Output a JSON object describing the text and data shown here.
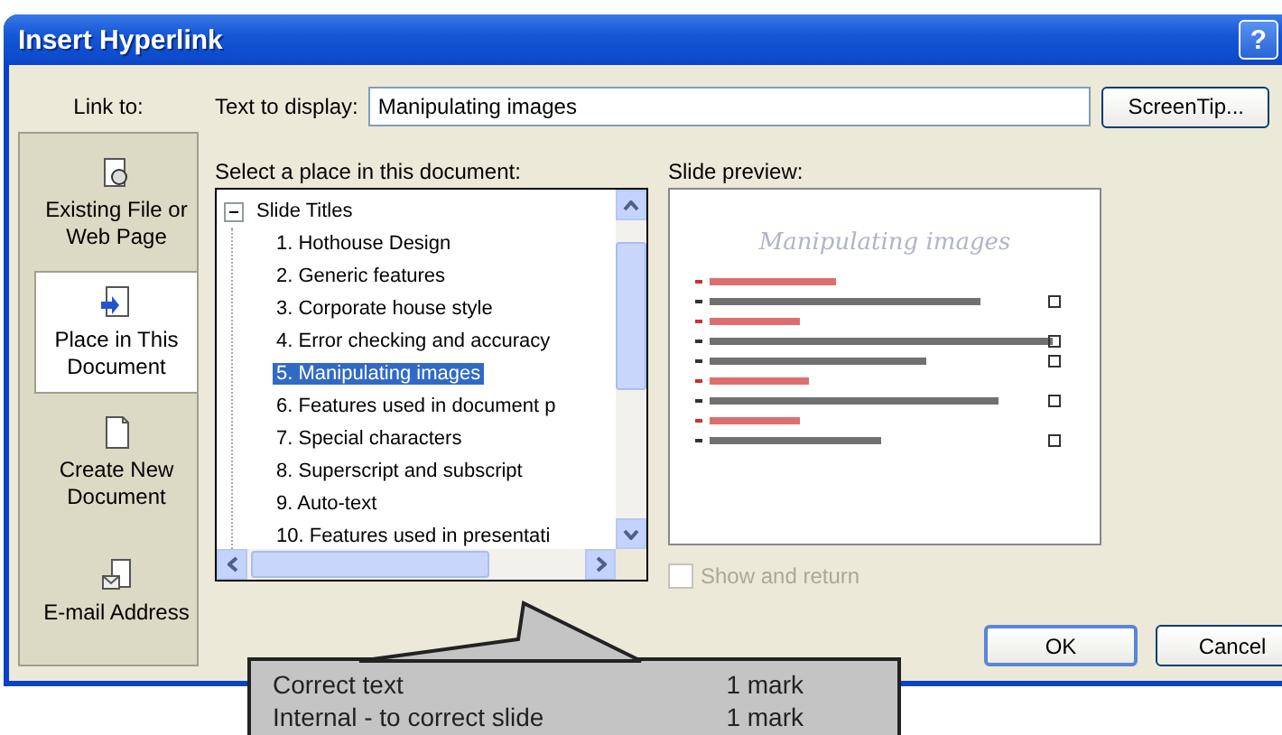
{
  "window": {
    "title": "Insert Hyperlink",
    "help_button": "?"
  },
  "link_to": {
    "label": "Link to:",
    "items": [
      {
        "kind": "file",
        "label": "Existing File or Web Page",
        "selected": false
      },
      {
        "kind": "place",
        "label": "Place in This Document",
        "selected": true
      },
      {
        "kind": "new",
        "label": "Create New Document",
        "selected": false
      },
      {
        "kind": "email",
        "label": "E-mail Address",
        "selected": false
      }
    ]
  },
  "text_to_display": {
    "label": "Text to display:",
    "value": "Manipulating images"
  },
  "screentip_button": {
    "label": "ScreenTip..."
  },
  "place_list": {
    "label": "Select a place in this document:",
    "root": {
      "label": "Slide Titles",
      "expanded": true,
      "children": [
        {
          "label": "1. Hothouse Design",
          "selected": false
        },
        {
          "label": "2. Generic features",
          "selected": false
        },
        {
          "label": "3. Corporate house style",
          "selected": false
        },
        {
          "label": "4. Error checking and accuracy",
          "selected": false
        },
        {
          "label": "5. Manipulating images",
          "selected": true
        },
        {
          "label": "6. Features used in document p",
          "selected": false
        },
        {
          "label": "7. Special characters",
          "selected": false
        },
        {
          "label": "8. Superscript and subscript",
          "selected": false
        },
        {
          "label": "9. Auto-text",
          "selected": false
        },
        {
          "label": "10. Features used in presentati",
          "selected": false
        }
      ]
    }
  },
  "slide_preview": {
    "label": "Slide preview:",
    "slide_title": "Manipulating images"
  },
  "show_and_return": {
    "label": "Show and return",
    "checked": false,
    "disabled": true
  },
  "buttons": [
    {
      "label": "OK",
      "default": true
    },
    {
      "label": "Cancel",
      "default": false
    }
  ],
  "callout": {
    "rows": [
      {
        "text": "Correct text",
        "marks": "1 mark"
      },
      {
        "text": "Internal - to correct slide",
        "marks": "1 mark"
      }
    ]
  }
}
